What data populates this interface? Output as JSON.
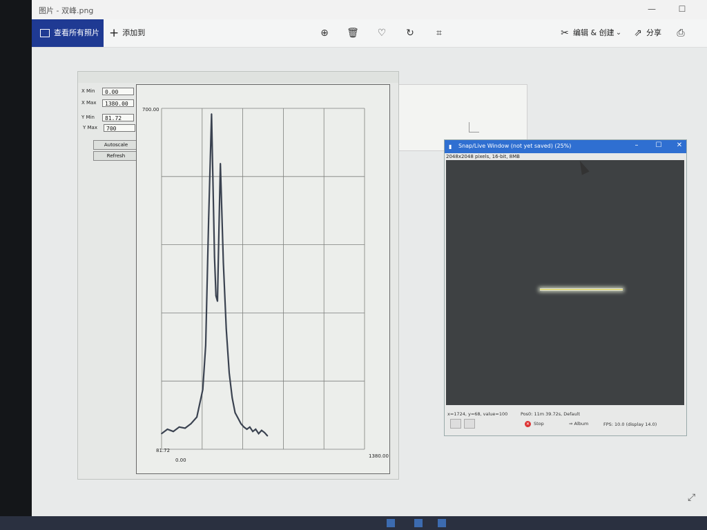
{
  "app": {
    "title": "图片 - 双峰.png",
    "toolbar": {
      "view_all_label": "查看所有照片",
      "add_to_label": "添加到",
      "edit_create_label": "编辑 & 创建",
      "share_label": "分享"
    }
  },
  "profile_window": {
    "controls": {
      "x_min_label": "X Min",
      "x_min_value": "0.00",
      "x_max_label": "X Max",
      "x_max_value": "1380.00",
      "y_min_label": "Y Min",
      "y_min_value": "81.72",
      "y_max_label": "Y Max",
      "y_max_value": "700",
      "autoscale_label": "Autoscale",
      "refresh_label": "Refresh"
    },
    "plot_labels": {
      "y_top": "700.00",
      "y_bottom": "81.72",
      "x_left": "0.00",
      "x_right": "1380.00"
    }
  },
  "snap_window": {
    "title": "Snap/Live Window (not yet saved) (25%)",
    "info": "2048x2048 pixels, 16-bit, 8MB",
    "status_coords": "x=1724, y=68, value=100",
    "status_pos": "Pos0: 11m 39.72s, Default",
    "stop_label": "Stop",
    "album_label": "Album",
    "fps_label": "FPS: 10.0 (display 14.0)"
  },
  "chart_data": {
    "type": "line",
    "xlim": [
      0,
      1380
    ],
    "ylim": [
      81.72,
      700
    ],
    "x": [
      0,
      40,
      80,
      120,
      160,
      200,
      240,
      280,
      300,
      320,
      340,
      360,
      370,
      380,
      390,
      400,
      420,
      440,
      460,
      480,
      500,
      520,
      540,
      560,
      580,
      600,
      620,
      640,
      660,
      680,
      700,
      720
    ],
    "values": [
      110,
      118,
      114,
      122,
      120,
      128,
      140,
      190,
      270,
      500,
      690,
      430,
      360,
      350,
      480,
      600,
      420,
      300,
      220,
      175,
      148,
      138,
      128,
      122,
      118,
      122,
      114,
      118,
      110,
      116,
      112,
      106
    ],
    "grid": true
  }
}
